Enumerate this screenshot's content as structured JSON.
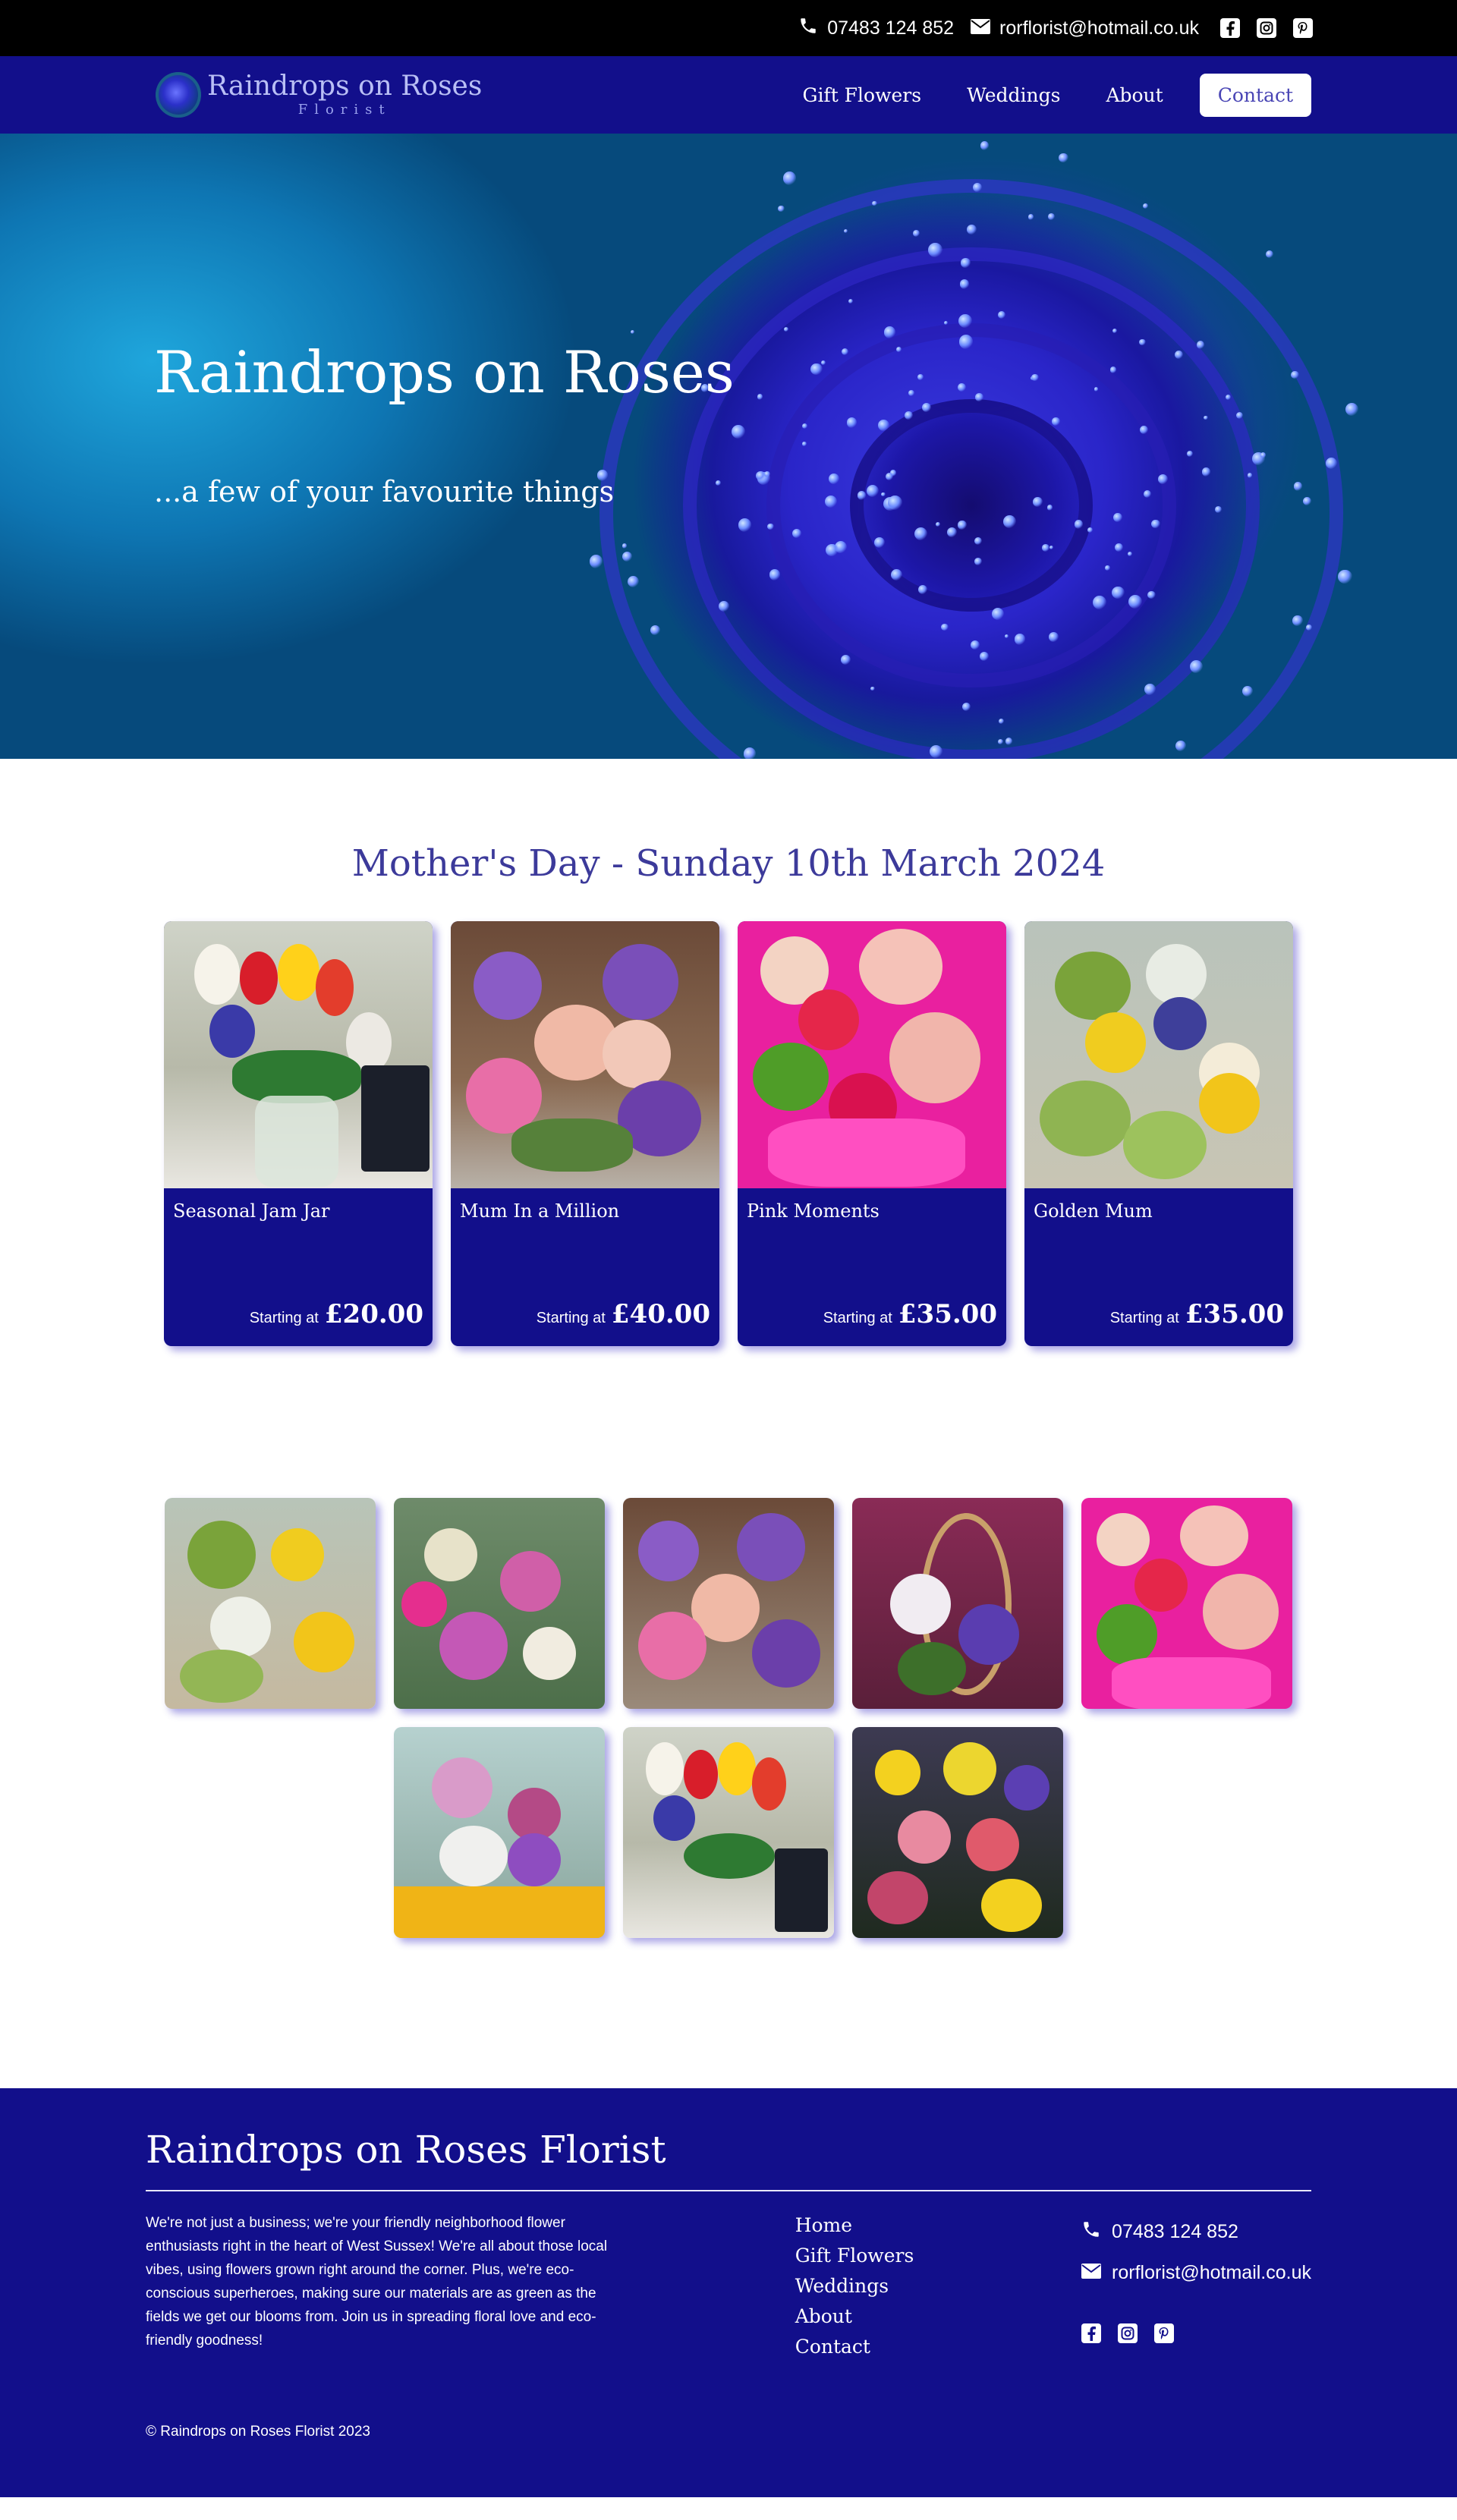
{
  "topbar": {
    "phone": "07483 124 852",
    "email": "rorflorist@hotmail.co.uk",
    "social_icons": [
      "facebook-icon",
      "instagram-icon",
      "pinterest-icon"
    ]
  },
  "nav": {
    "brand_name": "Raindrops on Roses",
    "brand_sub": "Florist",
    "links": [
      "Gift Flowers",
      "Weddings",
      "About",
      "Contact"
    ]
  },
  "hero": {
    "title": "Raindrops on Roses",
    "subtitle": "...a few of your favourite things"
  },
  "products_section": {
    "title": "Mother's Day - Sunday 10th March 2024",
    "products": [
      {
        "name": "Seasonal Jam Jar",
        "starting_label": "Starting at",
        "price": "£20.00"
      },
      {
        "name": "Mum In a Million",
        "starting_label": "Starting at",
        "price": "£40.00"
      },
      {
        "name": "Pink Moments",
        "starting_label": "Starting at",
        "price": "£35.00"
      },
      {
        "name": "Golden Mum",
        "starting_label": "Starting at",
        "price": "£35.00"
      }
    ]
  },
  "gallery": {
    "count": 8
  },
  "footer": {
    "title": "Raindrops on Roses Florist",
    "about": "We're not just a business; we're your friendly neighborhood flower enthusiasts right in the heart of West Sussex! We're all about those local vibes, using flowers grown right around the corner. Plus, we're eco-conscious superheroes, making sure our materials are as green as the fields we get our blooms from. Join us in spreading floral love and eco-friendly goodness!",
    "links": [
      "Home",
      "Gift Flowers",
      "Weddings",
      "About",
      "Contact"
    ],
    "phone": "07483 124 852",
    "email": "rorflorist@hotmail.co.uk",
    "copyright": "© Raindrops on Roses Florist 2023"
  },
  "colors": {
    "navy": "#120f8b",
    "topbar": "#000000",
    "title_purple": "#3c3a9a"
  }
}
